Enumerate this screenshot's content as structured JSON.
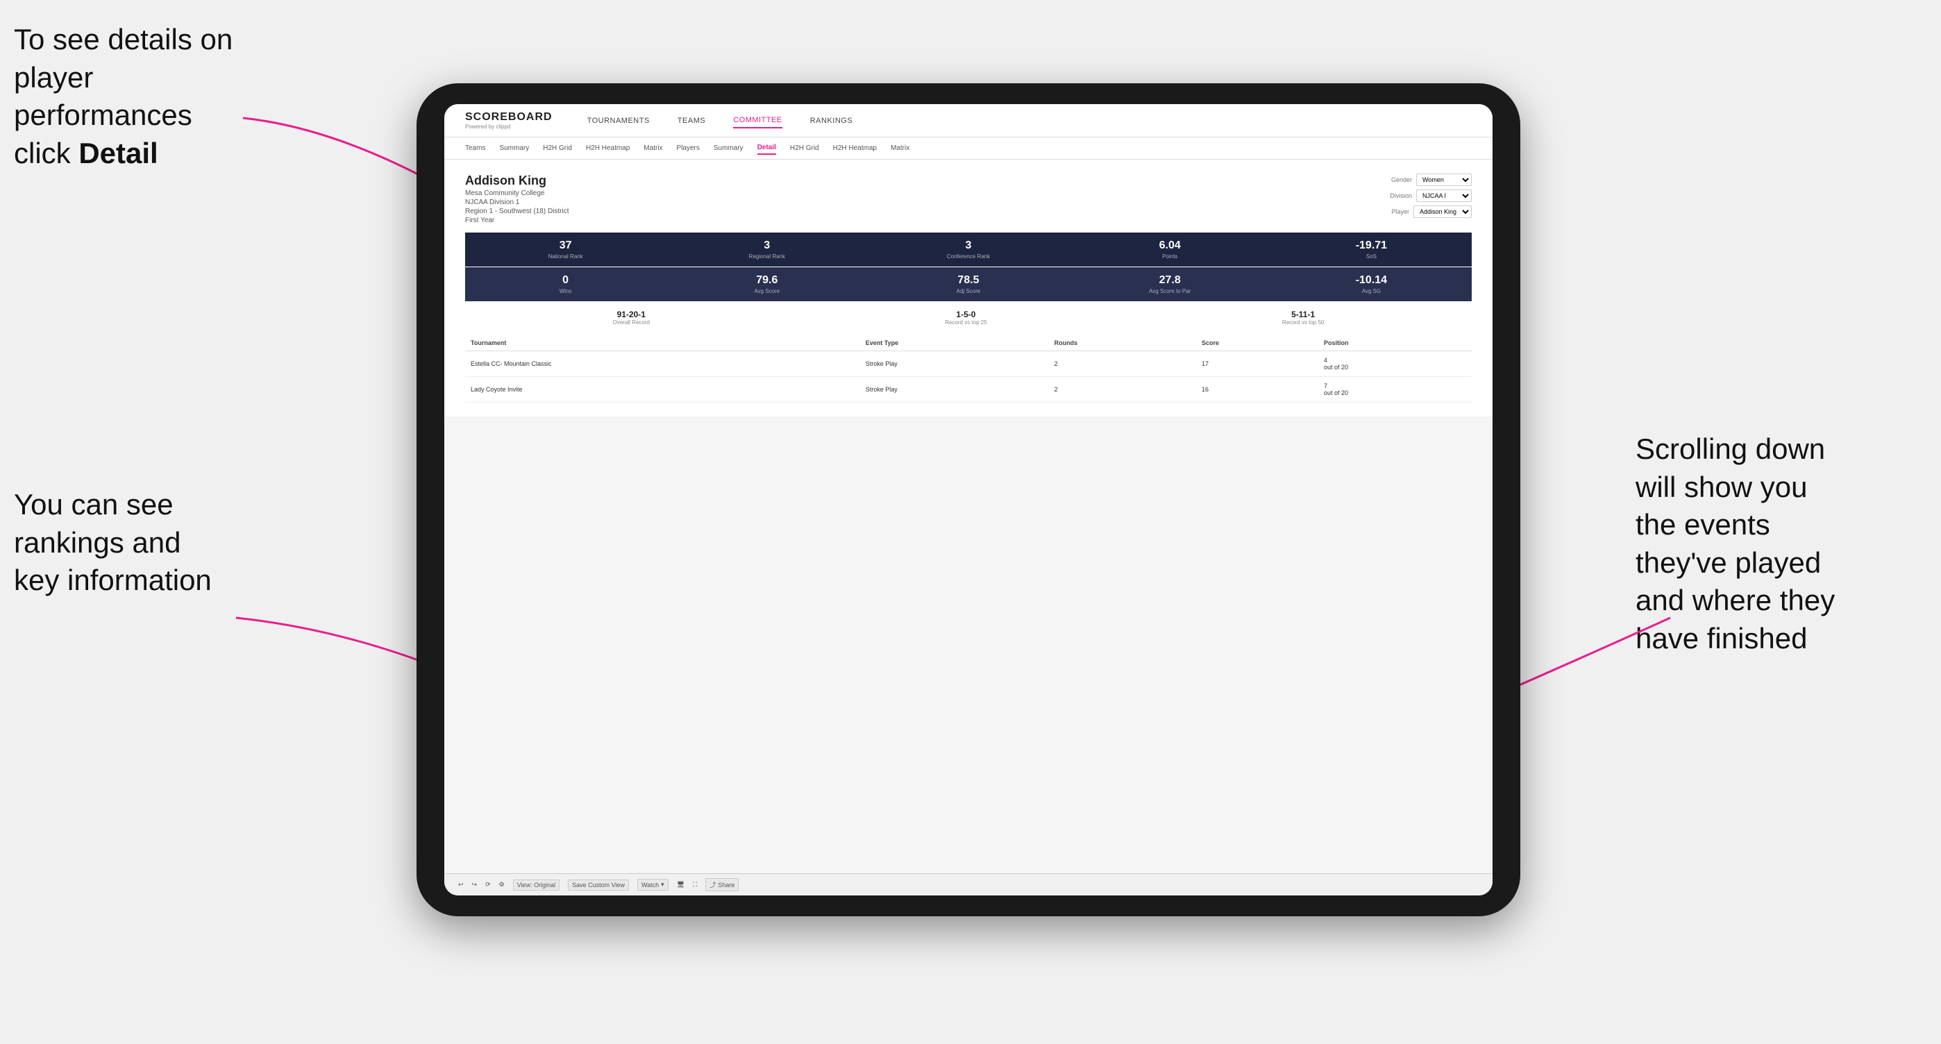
{
  "annotations": {
    "topleft_line1": "To see details on",
    "topleft_line2": "player performances",
    "topleft_line3": "click ",
    "topleft_bold": "Detail",
    "bottomleft_line1": "You can see",
    "bottomleft_line2": "rankings and",
    "bottomleft_line3": "key information",
    "right_line1": "Scrolling down",
    "right_line2": "will show you",
    "right_line3": "the events",
    "right_line4": "they've played",
    "right_line5": "and where they",
    "right_line6": "have finished"
  },
  "nav": {
    "logo": "SCOREBOARD",
    "logo_sub": "Powered by clippd",
    "items": [
      "TOURNAMENTS",
      "TEAMS",
      "COMMITTEE",
      "RANKINGS"
    ]
  },
  "subnav": {
    "items": [
      "Teams",
      "Summary",
      "H2H Grid",
      "H2H Heatmap",
      "Matrix",
      "Players",
      "Summary",
      "Detail",
      "H2H Grid",
      "H2H Heatmap",
      "Matrix"
    ]
  },
  "player": {
    "name": "Addison King",
    "school": "Mesa Community College",
    "division": "NJCAA Division 1",
    "region": "Region 1 - Southwest (18) District",
    "year": "First Year",
    "gender_label": "Gender",
    "gender_value": "Women",
    "division_label": "Division",
    "division_value": "NJCAA I",
    "player_label": "Player",
    "player_value": "Addison King"
  },
  "stats_row1": [
    {
      "value": "37",
      "label": "National Rank"
    },
    {
      "value": "3",
      "label": "Regional Rank"
    },
    {
      "value": "3",
      "label": "Conference Rank"
    },
    {
      "value": "6.04",
      "label": "Points"
    },
    {
      "value": "-19.71",
      "label": "SoS"
    }
  ],
  "stats_row2": [
    {
      "value": "0",
      "label": "Wins"
    },
    {
      "value": "79.6",
      "label": "Avg Score"
    },
    {
      "value": "78.5",
      "label": "Adj Score"
    },
    {
      "value": "27.8",
      "label": "Avg Score to Par"
    },
    {
      "value": "-10.14",
      "label": "Avg SG"
    }
  ],
  "records": [
    {
      "value": "91-20-1",
      "label": "Overall Record"
    },
    {
      "value": "1-5-0",
      "label": "Record vs top 25"
    },
    {
      "value": "5-11-1",
      "label": "Record vs top 50"
    }
  ],
  "table": {
    "headers": [
      "Tournament",
      "Event Type",
      "Rounds",
      "Score",
      "Position"
    ],
    "rows": [
      {
        "tournament": "Estella CC- Mountain Classic",
        "event_type": "Stroke Play",
        "rounds": "2",
        "score": "17",
        "position": "4 out of 20"
      },
      {
        "tournament": "Lady Coyote Invite",
        "event_type": "Stroke Play",
        "rounds": "2",
        "score": "16",
        "position": "7 out of 20"
      }
    ]
  },
  "toolbar": {
    "view_label": "View: Original",
    "save_label": "Save Custom View",
    "watch_label": "Watch",
    "share_label": "Share"
  }
}
